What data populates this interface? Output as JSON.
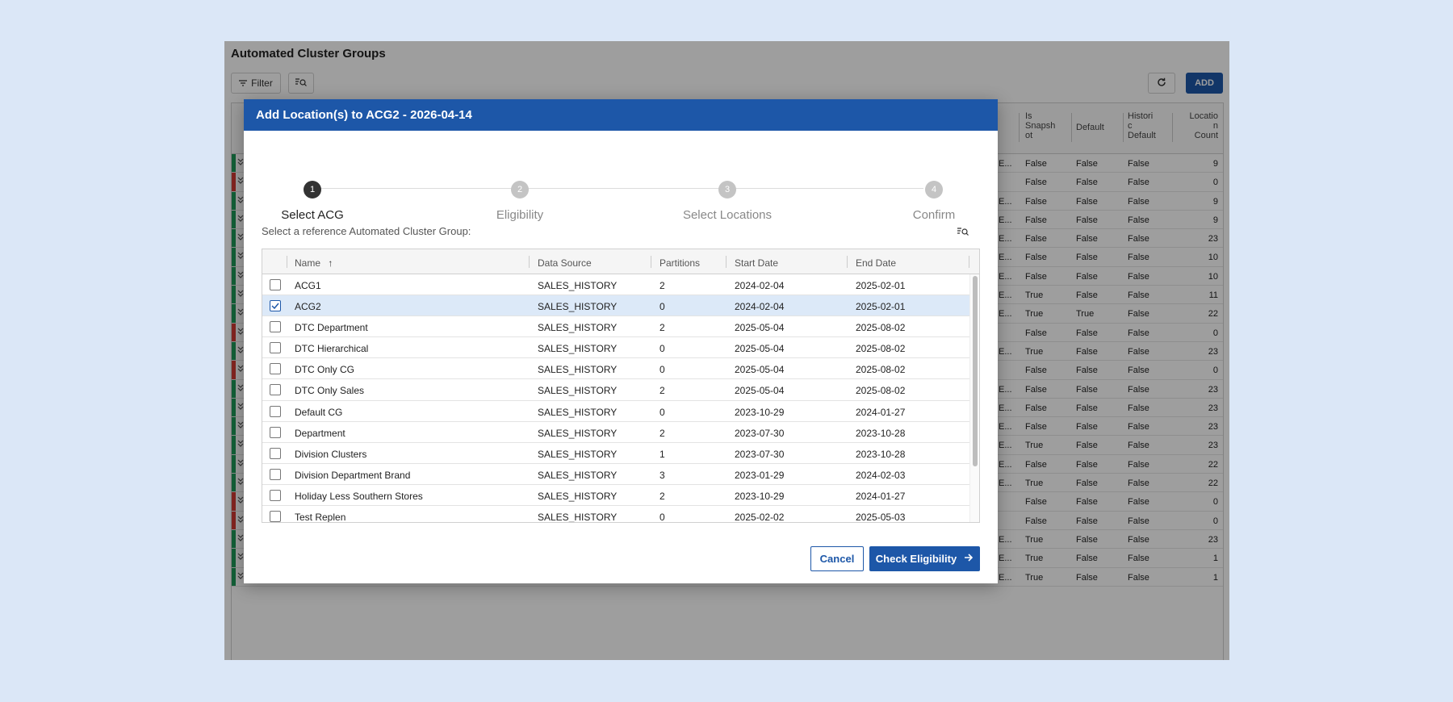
{
  "app": {
    "title": "Automated Cluster Groups",
    "filter_label": "Filter",
    "add_label": "ADD",
    "columns": [
      {
        "key": "is_snapshot",
        "label": "Is\nSnapsh\not"
      },
      {
        "key": "default",
        "label": "Default"
      },
      {
        "key": "historic_default",
        "label": "Histori\nc\nDefault"
      },
      {
        "key": "location_count",
        "label": "Locatio\nn\nCount"
      }
    ],
    "rows": [
      {
        "status": "green",
        "trunc": "E...",
        "is_snapshot": "False",
        "default": "False",
        "historic_default": "False",
        "count": "9"
      },
      {
        "status": "red",
        "trunc": "",
        "is_snapshot": "False",
        "default": "False",
        "historic_default": "False",
        "count": "0"
      },
      {
        "status": "green",
        "trunc": "E...",
        "is_snapshot": "False",
        "default": "False",
        "historic_default": "False",
        "count": "9"
      },
      {
        "status": "green",
        "trunc": "E...",
        "is_snapshot": "False",
        "default": "False",
        "historic_default": "False",
        "count": "9"
      },
      {
        "status": "green",
        "trunc": "E...",
        "is_snapshot": "False",
        "default": "False",
        "historic_default": "False",
        "count": "23"
      },
      {
        "status": "green",
        "trunc": "E...",
        "is_snapshot": "False",
        "default": "False",
        "historic_default": "False",
        "count": "10"
      },
      {
        "status": "green",
        "trunc": "E...",
        "is_snapshot": "False",
        "default": "False",
        "historic_default": "False",
        "count": "10"
      },
      {
        "status": "green",
        "trunc": "E...",
        "is_snapshot": "True",
        "default": "False",
        "historic_default": "False",
        "count": "11"
      },
      {
        "status": "green",
        "trunc": "E...",
        "is_snapshot": "True",
        "default": "True",
        "historic_default": "False",
        "count": "22"
      },
      {
        "status": "red",
        "trunc": "",
        "is_snapshot": "False",
        "default": "False",
        "historic_default": "False",
        "count": "0"
      },
      {
        "status": "green",
        "trunc": "E...",
        "is_snapshot": "True",
        "default": "False",
        "historic_default": "False",
        "count": "23"
      },
      {
        "status": "red",
        "trunc": "",
        "is_snapshot": "False",
        "default": "False",
        "historic_default": "False",
        "count": "0"
      },
      {
        "status": "green",
        "trunc": "E...",
        "is_snapshot": "False",
        "default": "False",
        "historic_default": "False",
        "count": "23"
      },
      {
        "status": "green",
        "trunc": "E...",
        "is_snapshot": "False",
        "default": "False",
        "historic_default": "False",
        "count": "23"
      },
      {
        "status": "green",
        "trunc": "E...",
        "is_snapshot": "False",
        "default": "False",
        "historic_default": "False",
        "count": "23"
      },
      {
        "status": "green",
        "trunc": "E...",
        "is_snapshot": "True",
        "default": "False",
        "historic_default": "False",
        "count": "23"
      },
      {
        "status": "green",
        "trunc": "E...",
        "is_snapshot": "False",
        "default": "False",
        "historic_default": "False",
        "count": "22"
      },
      {
        "status": "green",
        "trunc": "E...",
        "is_snapshot": "True",
        "default": "False",
        "historic_default": "False",
        "count": "22"
      },
      {
        "status": "red",
        "trunc": "",
        "is_snapshot": "False",
        "default": "False",
        "historic_default": "False",
        "count": "0"
      },
      {
        "status": "red",
        "trunc": "",
        "is_snapshot": "False",
        "default": "False",
        "historic_default": "False",
        "count": "0"
      },
      {
        "status": "green",
        "trunc": "E...",
        "is_snapshot": "True",
        "default": "False",
        "historic_default": "False",
        "count": "23"
      },
      {
        "status": "green",
        "trunc": "E...",
        "is_snapshot": "True",
        "default": "False",
        "historic_default": "False",
        "count": "1"
      },
      {
        "status": "green",
        "trunc": "E...",
        "is_snapshot": "True",
        "default": "False",
        "historic_default": "False",
        "count": "1"
      }
    ]
  },
  "modal": {
    "title": "Add Location(s) to ACG2 - 2026-04-14",
    "steps": [
      {
        "number": "1",
        "label": "Select ACG",
        "active": true
      },
      {
        "number": "2",
        "label": "Eligibility",
        "active": false
      },
      {
        "number": "3",
        "label": "Select Locations",
        "active": false
      },
      {
        "number": "4",
        "label": "Confirm",
        "active": false
      }
    ],
    "reference_label": "Select a reference Automated Cluster Group:",
    "grid": {
      "columns": {
        "name": "Name",
        "sort_indicator": "↑",
        "data_source": "Data Source",
        "partitions": "Partitions",
        "start_date": "Start Date",
        "end_date": "End Date"
      },
      "rows": [
        {
          "name": "ACG1",
          "data_source": "SALES_HISTORY",
          "partitions": "2",
          "start_date": "2024-02-04",
          "end_date": "2025-02-01",
          "checked": false
        },
        {
          "name": "ACG2",
          "data_source": "SALES_HISTORY",
          "partitions": "0",
          "start_date": "2024-02-04",
          "end_date": "2025-02-01",
          "checked": true
        },
        {
          "name": "DTC Department",
          "data_source": "SALES_HISTORY",
          "partitions": "2",
          "start_date": "2025-05-04",
          "end_date": "2025-08-02",
          "checked": false
        },
        {
          "name": "DTC Hierarchical",
          "data_source": "SALES_HISTORY",
          "partitions": "0",
          "start_date": "2025-05-04",
          "end_date": "2025-08-02",
          "checked": false
        },
        {
          "name": "DTC Only CG",
          "data_source": "SALES_HISTORY",
          "partitions": "0",
          "start_date": "2025-05-04",
          "end_date": "2025-08-02",
          "checked": false
        },
        {
          "name": "DTC Only Sales",
          "data_source": "SALES_HISTORY",
          "partitions": "2",
          "start_date": "2025-05-04",
          "end_date": "2025-08-02",
          "checked": false
        },
        {
          "name": "Default CG",
          "data_source": "SALES_HISTORY",
          "partitions": "0",
          "start_date": "2023-10-29",
          "end_date": "2024-01-27",
          "checked": false
        },
        {
          "name": "Department",
          "data_source": "SALES_HISTORY",
          "partitions": "2",
          "start_date": "2023-07-30",
          "end_date": "2023-10-28",
          "checked": false
        },
        {
          "name": "Division Clusters",
          "data_source": "SALES_HISTORY",
          "partitions": "1",
          "start_date": "2023-07-30",
          "end_date": "2023-10-28",
          "checked": false
        },
        {
          "name": "Division Department Brand",
          "data_source": "SALES_HISTORY",
          "partitions": "3",
          "start_date": "2023-01-29",
          "end_date": "2024-02-03",
          "checked": false
        },
        {
          "name": "Holiday Less Southern Stores",
          "data_source": "SALES_HISTORY",
          "partitions": "2",
          "start_date": "2023-10-29",
          "end_date": "2024-01-27",
          "checked": false
        },
        {
          "name": "Test Replen",
          "data_source": "SALES_HISTORY",
          "partitions": "0",
          "start_date": "2025-02-02",
          "end_date": "2025-05-03",
          "checked": false
        }
      ]
    },
    "cancel_label": "Cancel",
    "check_label": "Check Eligibility"
  },
  "colors": {
    "primary": "#1d57a8",
    "status_green": "#1e9a5a",
    "status_red": "#d33a35",
    "selected_row": "#dce9f8"
  },
  "icons": [
    "filter-icon",
    "search-list-icon",
    "refresh-icon",
    "expand-chevrons-icon",
    "checkmark-icon",
    "arrow-right-icon"
  ]
}
